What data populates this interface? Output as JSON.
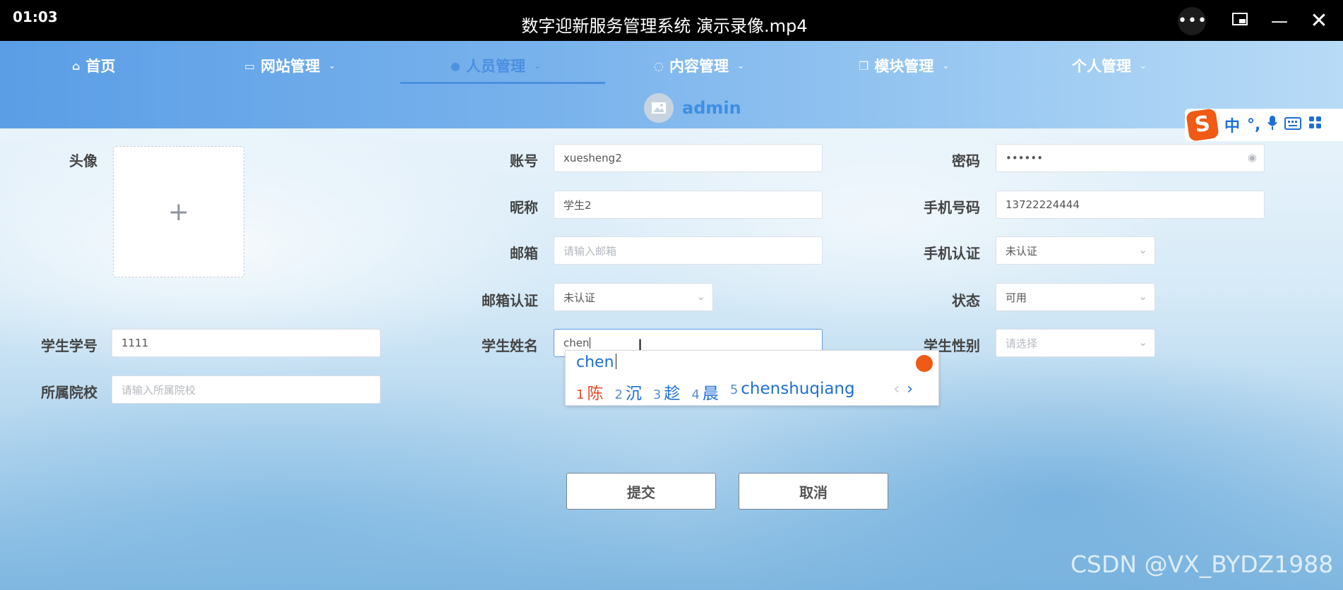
{
  "window": {
    "time": "01:03",
    "title": "数字迎新服务管理系统 演示录像.mp4",
    "more_icon": "more-dots-icon",
    "pip_icon": "picture-in-picture-icon",
    "minimize_icon": "minimize-icon",
    "close_icon": "close-icon"
  },
  "nav": {
    "items": [
      {
        "label": "首页",
        "icon": "home-icon"
      },
      {
        "label": "网站管理",
        "icon": "monitor-icon"
      },
      {
        "label": "人员管理",
        "icon": "user-icon",
        "active": true
      },
      {
        "label": "内容管理",
        "icon": "message-icon"
      },
      {
        "label": "模块管理",
        "icon": "copy-icon"
      },
      {
        "label": "个人管理",
        "icon": ""
      }
    ],
    "username": "admin"
  },
  "ime_toolbar": {
    "logo": "S",
    "mode": "中",
    "punct": "°,",
    "mic_icon": "microphone-icon",
    "keyboard_icon": "keyboard-icon",
    "apps_icon": "apps-icon"
  },
  "form": {
    "avatar_label": "头像",
    "avatar_upload": "+",
    "account_label": "账号",
    "account_value": "xuesheng2",
    "password_label": "密码",
    "password_value": "••••••",
    "nickname_label": "昵称",
    "nickname_value": "学生2",
    "phone_label": "手机号码",
    "phone_value": "13722224444",
    "email_label": "邮箱",
    "email_placeholder": "请输入邮箱",
    "phone_verify_label": "手机认证",
    "phone_verify_value": "未认证",
    "email_verify_label": "邮箱认证",
    "email_verify_value": "未认证",
    "status_label": "状态",
    "status_value": "可用",
    "student_no_label": "学生学号",
    "student_no_value": "1111",
    "student_name_label": "学生姓名",
    "student_name_value": "chen",
    "gender_label": "学生性别",
    "gender_placeholder": "请选择",
    "school_label": "所属院校",
    "school_placeholder": "请输入所属院校"
  },
  "ime_popup": {
    "composition": "chen",
    "candidates": [
      {
        "n": "1",
        "text": "陈"
      },
      {
        "n": "2",
        "text": "沉"
      },
      {
        "n": "3",
        "text": "趁"
      },
      {
        "n": "4",
        "text": "晨"
      },
      {
        "n": "5",
        "text": "chenshuqiang"
      }
    ],
    "prev": "‹",
    "next": "›"
  },
  "buttons": {
    "submit": "提交",
    "cancel": "取消"
  },
  "watermark": "CSDN @VX_BYDZ1988"
}
